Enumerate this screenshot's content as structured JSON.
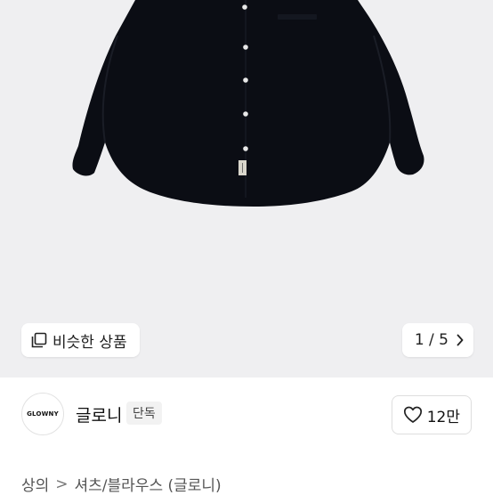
{
  "gallery": {
    "similar_label": "비슷한 상품",
    "pager": "1 / 5",
    "background_color": "#efeff1",
    "product_color": "#0b0d14"
  },
  "seller": {
    "logo_text": "GLOWNY",
    "name": "글로니",
    "badge": "단독",
    "likes": "12만"
  },
  "breadcrumb": {
    "category": "상의",
    "separator": ">",
    "subcategory": "셔츠/블라우스 (글로니)"
  }
}
